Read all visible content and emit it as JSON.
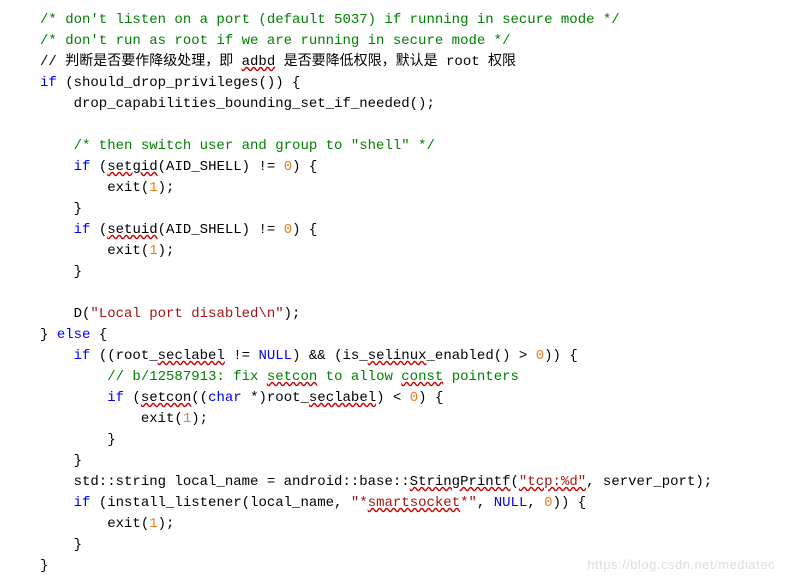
{
  "code": {
    "c1": "/* don't listen on a port (default 5037) if running in secure mode */",
    "c2": "/* don't run as root if we are running in secure mode */",
    "c3a": "// 判断是否要作降级处理，即 ",
    "c3b": "adbd",
    "c3c": " 是否要降低权限，默认是 root 权限",
    "l4a": "if",
    "l4b": " (should_drop_privileges()) {",
    "l5": "    drop_capabilities_bounding_set_if_needed();",
    "c6": "    /* then switch user and group to \"shell\" */",
    "l7a": "    ",
    "l7b": "if",
    "l7c": " (",
    "l7d": "setgid",
    "l7e": "(AID_SHELL) != ",
    "l7f": "0",
    "l7g": ") {",
    "l8a": "        exit(",
    "l8b": "1",
    "l8c": ");",
    "l9": "    }",
    "l10a": "    ",
    "l10b": "if",
    "l10c": " (",
    "l10d": "setuid",
    "l10e": "(AID_SHELL) != ",
    "l10f": "0",
    "l10g": ") {",
    "l11a": "        exit(",
    "l11b": "1",
    "l11c": ");",
    "l12": "    }",
    "l13a": "    D(",
    "l13b": "\"Local port disabled\\n\"",
    "l13c": ");",
    "l14a": "} ",
    "l14b": "else",
    "l14c": " {",
    "l15a": "    ",
    "l15b": "if",
    "l15c": " ((root_",
    "l15d": "seclabel",
    "l15e": " != ",
    "l15f": "NULL",
    "l15g": ") && (is_",
    "l15h": "selinux",
    "l15i": "_enabled() > ",
    "l15j": "0",
    "l15k": ")) {",
    "c16a": "        // b/12587913: fix ",
    "c16b": "setcon",
    "c16c": " to allow ",
    "c16d": "const",
    "c16e": " pointers",
    "l17a": "        ",
    "l17b": "if",
    "l17c": " (",
    "l17d": "setcon",
    "l17e": "((",
    "l17f": "char",
    "l17g": " *)root_",
    "l17h": "seclabel",
    "l17i": ") < ",
    "l17j": "0",
    "l17k": ") {",
    "l18a": "            exit(",
    "l18b": "1",
    "l18c": ");",
    "l19": "        }",
    "l20": "    }",
    "l21a": "    std::string local_name = android::base::",
    "l21b": "StringPrintf",
    "l21c": "(",
    "l21d": "\"tcp:%d\"",
    "l21e": ", server_port);",
    "l22a": "    ",
    "l22b": "if",
    "l22c": " (install_listener(local_name, ",
    "l22d": "\"*",
    "l22e": "smartsocket",
    "l22f": "*\"",
    "l22g": ", ",
    "l22h": "NULL",
    "l22i": ", ",
    "l22j": "0",
    "l22k": ")) {",
    "l23a": "        exit(",
    "l23b": "1",
    "l23c": ");",
    "l24": "    }",
    "l25": "}"
  },
  "watermark": "https://blog.csdn.net/mediatec"
}
